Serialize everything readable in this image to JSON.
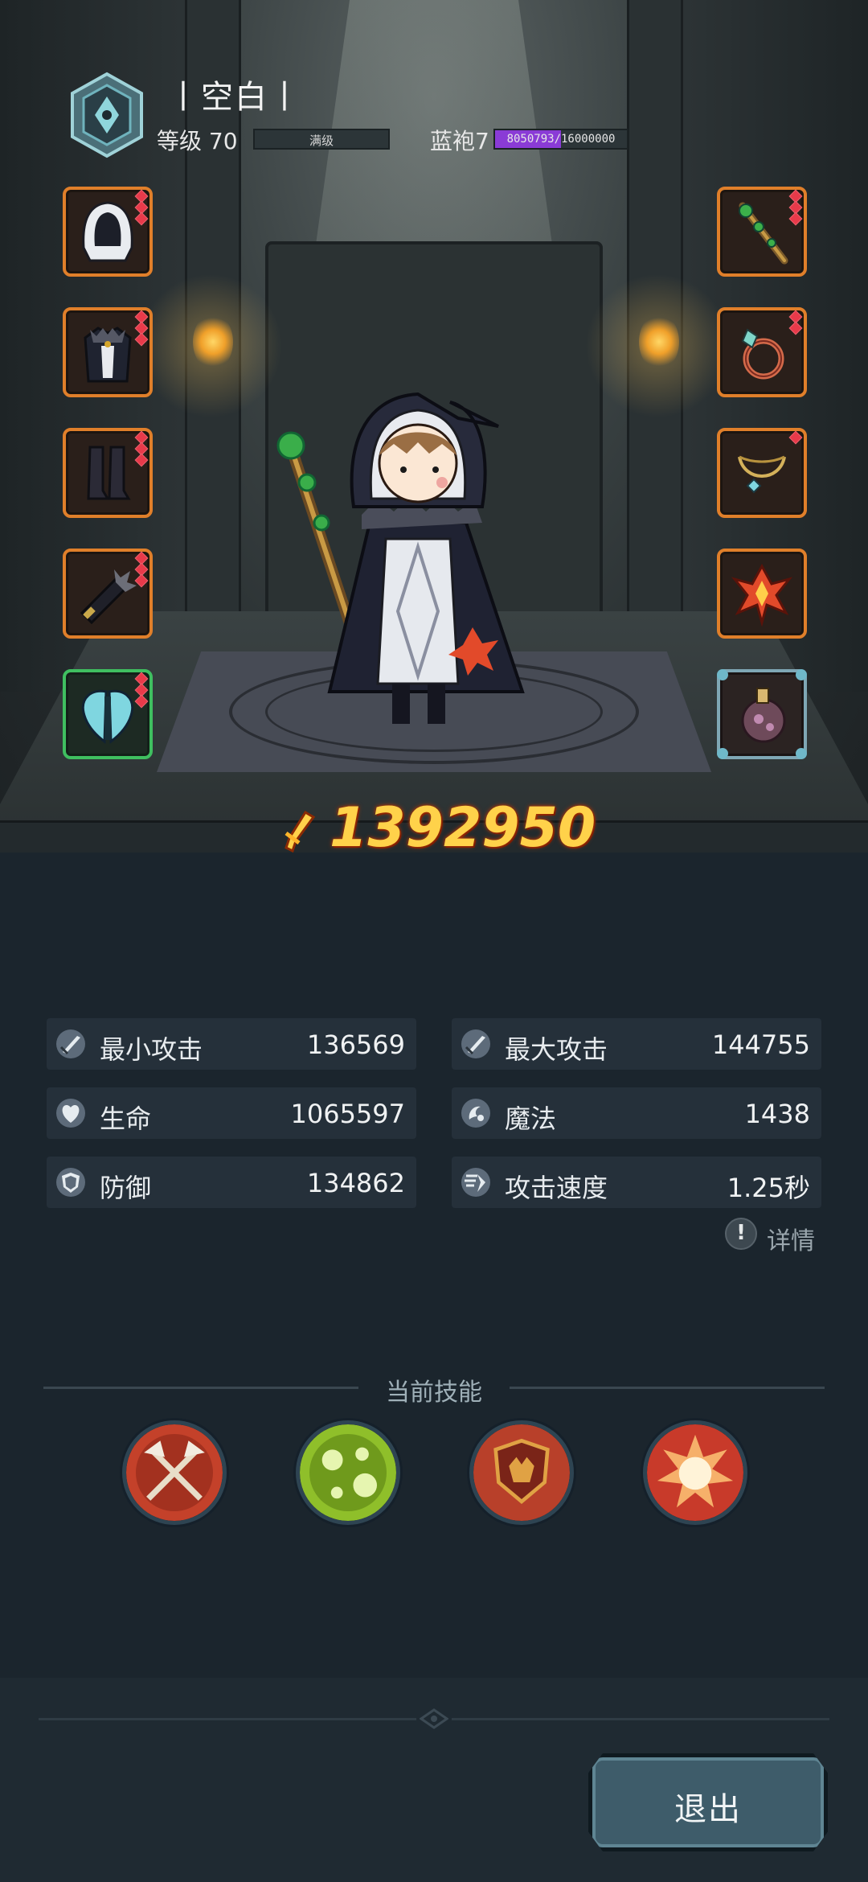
{
  "header": {
    "player_name": "丨空白丨",
    "level_label": "等级 70",
    "level_bar_text": "满级",
    "rank_label": "蓝袍7",
    "exp_text": "8050793/16000000",
    "exp_fraction": 0.503
  },
  "equipment": {
    "left": [
      {
        "name": "hood",
        "icon": "hood-icon",
        "gems": 3
      },
      {
        "name": "armor",
        "icon": "fur-armor-icon",
        "gems": 3
      },
      {
        "name": "boots",
        "icon": "boots-icon",
        "gems": 3
      },
      {
        "name": "gloves",
        "icon": "gauntlet-icon",
        "gems": 3
      },
      {
        "name": "wings",
        "icon": "wings-icon",
        "gems": 3
      }
    ],
    "right": [
      {
        "name": "staff",
        "icon": "staff-icon",
        "gems": 3
      },
      {
        "name": "ring",
        "icon": "ring-icon",
        "gems": 2
      },
      {
        "name": "necklace",
        "icon": "necklace-icon",
        "gems": 1
      },
      {
        "name": "emblem",
        "icon": "emblem-icon",
        "gems": 0
      },
      {
        "name": "potion",
        "icon": "potion-icon",
        "gems": 0
      }
    ]
  },
  "power": "1392950",
  "stats": [
    {
      "name": "最小攻击",
      "value": "136569",
      "icon": "sword-icon"
    },
    {
      "name": "最大攻击",
      "value": "144755",
      "icon": "sword-icon"
    },
    {
      "name": "生命",
      "value": "1065597",
      "icon": "heart-icon"
    },
    {
      "name": "魔法",
      "value": "1438",
      "icon": "magic-icon"
    },
    {
      "name": "防御",
      "value": "134862",
      "icon": "shield-icon"
    },
    {
      "name": "攻击速度",
      "value": "1.25秒",
      "icon": "speed-icon"
    }
  ],
  "detail_label": "详情",
  "skills": {
    "title": "当前技能",
    "items": [
      {
        "icon": "crossed-axes-icon",
        "color": "#c4412a"
      },
      {
        "icon": "poison-bubbles-icon",
        "color": "#8fbf2a"
      },
      {
        "icon": "guard-shield-icon",
        "color": "#b8402a"
      },
      {
        "icon": "explosion-icon",
        "color": "#f2a25a"
      }
    ]
  },
  "exit_label": "退出",
  "colors": {
    "background": "#1b252d",
    "power_text": "#ffd24a",
    "slot_orange": "#e07f2a",
    "slot_green": "#3fbf60",
    "exp_fill": "#8a3bd6"
  }
}
